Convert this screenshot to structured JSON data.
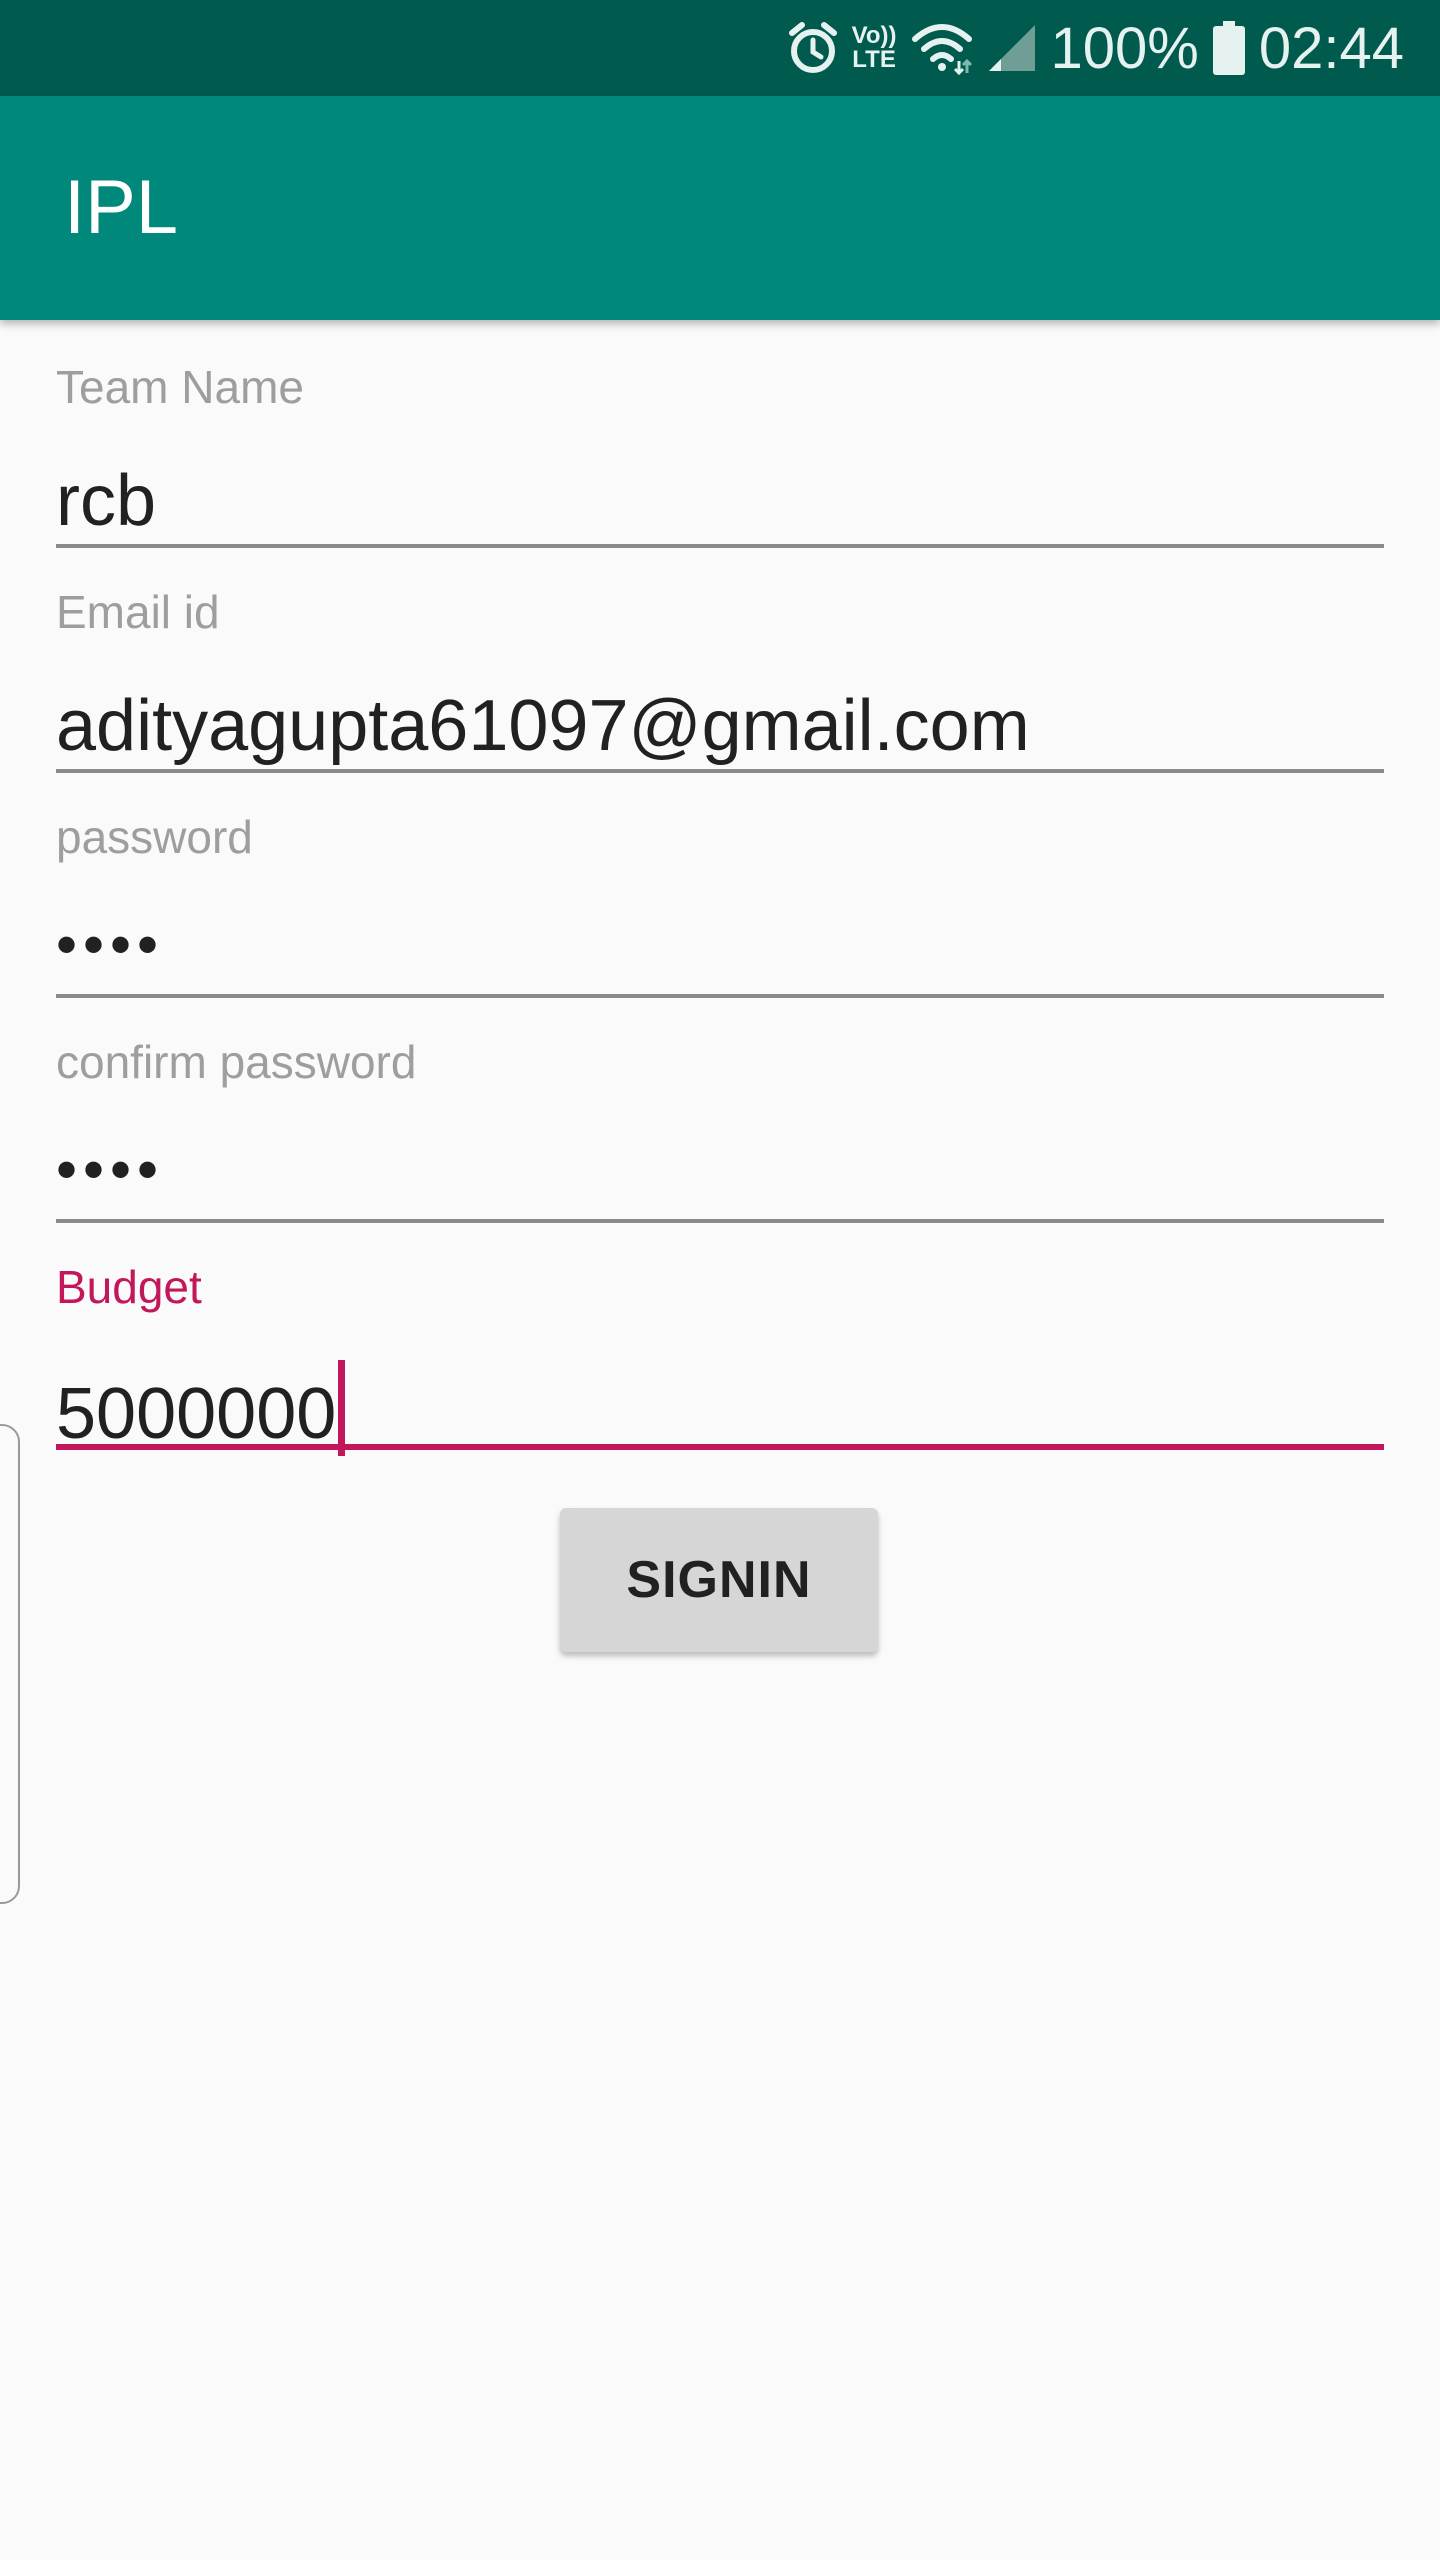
{
  "status_bar": {
    "icons": [
      "alarm-icon",
      "volte-icon",
      "wifi-icon",
      "signal-icon",
      "battery-icon"
    ],
    "volte_top": "Vo))",
    "volte_bottom": "LTE",
    "battery": "100%",
    "time": "02:44"
  },
  "app_bar": {
    "title": "IPL",
    "color": "#00897b"
  },
  "form": {
    "team_name": {
      "label": "Team Name",
      "value": "rcb"
    },
    "email": {
      "label": "Email id",
      "value": "adityagupta61097@gmail.com"
    },
    "password": {
      "label": "password",
      "value": "••••"
    },
    "confirm_password": {
      "label": "confirm password",
      "value": "••••"
    },
    "budget": {
      "label": "Budget",
      "value": "5000000"
    },
    "focus_color": "#c2185b"
  },
  "signin_button": {
    "label": "SIGNIN"
  }
}
